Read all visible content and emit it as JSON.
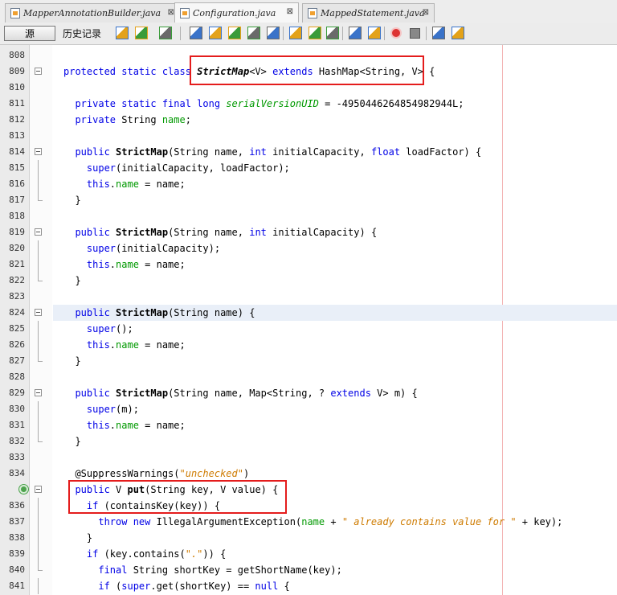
{
  "tabs": [
    {
      "label": "MapperAnnotationBuilder.java",
      "close": "⊠",
      "active": false
    },
    {
      "label": "Configuration.java",
      "close": "⊠",
      "active": true
    },
    {
      "label": "MappedStatement.java",
      "close": "⊠",
      "active": false
    }
  ],
  "toolbar": {
    "source_label": "源",
    "history_label": "历史记录",
    "icons": [
      "last-edit-icon",
      "back-icon",
      "forward-icon",
      "find-selection-icon",
      "find-previous-icon",
      "find-next-icon",
      "toggle-highlight-icon",
      "toggle-rect-select-icon",
      "previous-bookmark-icon",
      "next-bookmark-icon",
      "toggle-bookmark-icon",
      "shift-left-icon",
      "shift-right-icon",
      "start-macro-icon",
      "stop-macro-icon",
      "comment-icon",
      "uncomment-icon"
    ]
  },
  "editor": {
    "lines": [
      {
        "n": "808",
        "segs": []
      },
      {
        "n": "809",
        "segs": [
          [
            "kw",
            "protected static class "
          ],
          [
            "bi",
            "StrictMap"
          ],
          [
            "",
            "<V> "
          ],
          [
            "kw",
            "extends"
          ],
          [
            "",
            " HashMap<String, V> {"
          ]
        ]
      },
      {
        "n": "810",
        "segs": []
      },
      {
        "n": "811",
        "segs": [
          [
            "kw",
            "  private static final long "
          ],
          [
            "sfield",
            "serialVersionUID"
          ],
          [
            "",
            " = -4950446264854982944L;"
          ]
        ]
      },
      {
        "n": "812",
        "segs": [
          [
            "kw",
            "  private "
          ],
          [
            "",
            "String "
          ],
          [
            "field",
            "name"
          ],
          [
            "",
            ";"
          ]
        ]
      },
      {
        "n": "813",
        "segs": []
      },
      {
        "n": "814",
        "segs": [
          [
            "kw",
            "  public "
          ],
          [
            "bold",
            "StrictMap"
          ],
          [
            "",
            "(String name, "
          ],
          [
            "kw",
            "int"
          ],
          [
            "",
            " initialCapacity, "
          ],
          [
            "kw",
            "float"
          ],
          [
            "",
            " loadFactor) {"
          ]
        ]
      },
      {
        "n": "815",
        "segs": [
          [
            "kw",
            "    super"
          ],
          [
            "",
            "(initialCapacity, loadFactor);"
          ]
        ]
      },
      {
        "n": "816",
        "segs": [
          [
            "kw",
            "    this"
          ],
          [
            "",
            "."
          ],
          [
            "field",
            "name"
          ],
          [
            "",
            " = name;"
          ]
        ]
      },
      {
        "n": "817",
        "segs": [
          [
            "",
            "  }"
          ]
        ]
      },
      {
        "n": "818",
        "segs": []
      },
      {
        "n": "819",
        "segs": [
          [
            "kw",
            "  public "
          ],
          [
            "bold",
            "StrictMap"
          ],
          [
            "",
            "(String name, "
          ],
          [
            "kw",
            "int"
          ],
          [
            "",
            " initialCapacity) {"
          ]
        ]
      },
      {
        "n": "820",
        "segs": [
          [
            "kw",
            "    super"
          ],
          [
            "",
            "(initialCapacity);"
          ]
        ]
      },
      {
        "n": "821",
        "segs": [
          [
            "kw",
            "    this"
          ],
          [
            "",
            "."
          ],
          [
            "field",
            "name"
          ],
          [
            "",
            " = name;"
          ]
        ]
      },
      {
        "n": "822",
        "segs": [
          [
            "",
            "  }"
          ]
        ]
      },
      {
        "n": "823",
        "segs": []
      },
      {
        "n": "824",
        "segs": [
          [
            "kw",
            "  public "
          ],
          [
            "bold",
            "StrictMap"
          ],
          [
            "",
            "(String name) {"
          ]
        ]
      },
      {
        "n": "825",
        "segs": [
          [
            "kw",
            "    super"
          ],
          [
            "",
            "();"
          ]
        ]
      },
      {
        "n": "826",
        "segs": [
          [
            "kw",
            "    this"
          ],
          [
            "",
            "."
          ],
          [
            "field",
            "name"
          ],
          [
            "",
            " = name;"
          ]
        ]
      },
      {
        "n": "827",
        "segs": [
          [
            "",
            "  }"
          ]
        ]
      },
      {
        "n": "828",
        "segs": []
      },
      {
        "n": "829",
        "segs": [
          [
            "kw",
            "  public "
          ],
          [
            "bold",
            "StrictMap"
          ],
          [
            "",
            "(String name, Map<String, ? "
          ],
          [
            "kw",
            "extends"
          ],
          [
            "",
            " V> m) {"
          ]
        ]
      },
      {
        "n": "830",
        "segs": [
          [
            "kw",
            "    super"
          ],
          [
            "",
            "(m);"
          ]
        ]
      },
      {
        "n": "831",
        "segs": [
          [
            "kw",
            "    this"
          ],
          [
            "",
            "."
          ],
          [
            "field",
            "name"
          ],
          [
            "",
            " = name;"
          ]
        ]
      },
      {
        "n": "832",
        "segs": [
          [
            "",
            "  }"
          ]
        ]
      },
      {
        "n": "833",
        "segs": []
      },
      {
        "n": "834",
        "segs": [
          [
            "ann",
            "  @SuppressWarnings("
          ],
          [
            "str",
            "\"unchecked\""
          ],
          [
            "",
            ")"
          ]
        ]
      },
      {
        "n": "",
        "segs": [
          [
            "kw",
            "  public "
          ],
          [
            "",
            "V "
          ],
          [
            "bold",
            "put"
          ],
          [
            "",
            "(String key, V value) {"
          ]
        ]
      },
      {
        "n": "836",
        "segs": [
          [
            "kw",
            "    if"
          ],
          [
            "",
            " (containsKey(key)) {"
          ]
        ]
      },
      {
        "n": "837",
        "segs": [
          [
            "kw",
            "      throw new "
          ],
          [
            "",
            "IllegalArgumentException("
          ],
          [
            "field",
            "name"
          ],
          [
            "",
            " + "
          ],
          [
            "str",
            "\" already contains value for \""
          ],
          [
            "",
            " + key);"
          ]
        ]
      },
      {
        "n": "838",
        "segs": [
          [
            "",
            "    }"
          ]
        ]
      },
      {
        "n": "839",
        "segs": [
          [
            "kw",
            "    if"
          ],
          [
            "",
            " (key.contains("
          ],
          [
            "str",
            "\".\""
          ],
          [
            "",
            ")) {"
          ]
        ]
      },
      {
        "n": "840",
        "segs": [
          [
            "kw",
            "      final "
          ],
          [
            "",
            "String shortKey = getShortName(key);"
          ]
        ]
      },
      {
        "n": "841",
        "segs": [
          [
            "kw",
            "      if"
          ],
          [
            "",
            " ("
          ],
          [
            "kw",
            "super"
          ],
          [
            "",
            ".get(shortKey) == "
          ],
          [
            "kw",
            "null"
          ],
          [
            "",
            " {"
          ]
        ]
      }
    ]
  }
}
